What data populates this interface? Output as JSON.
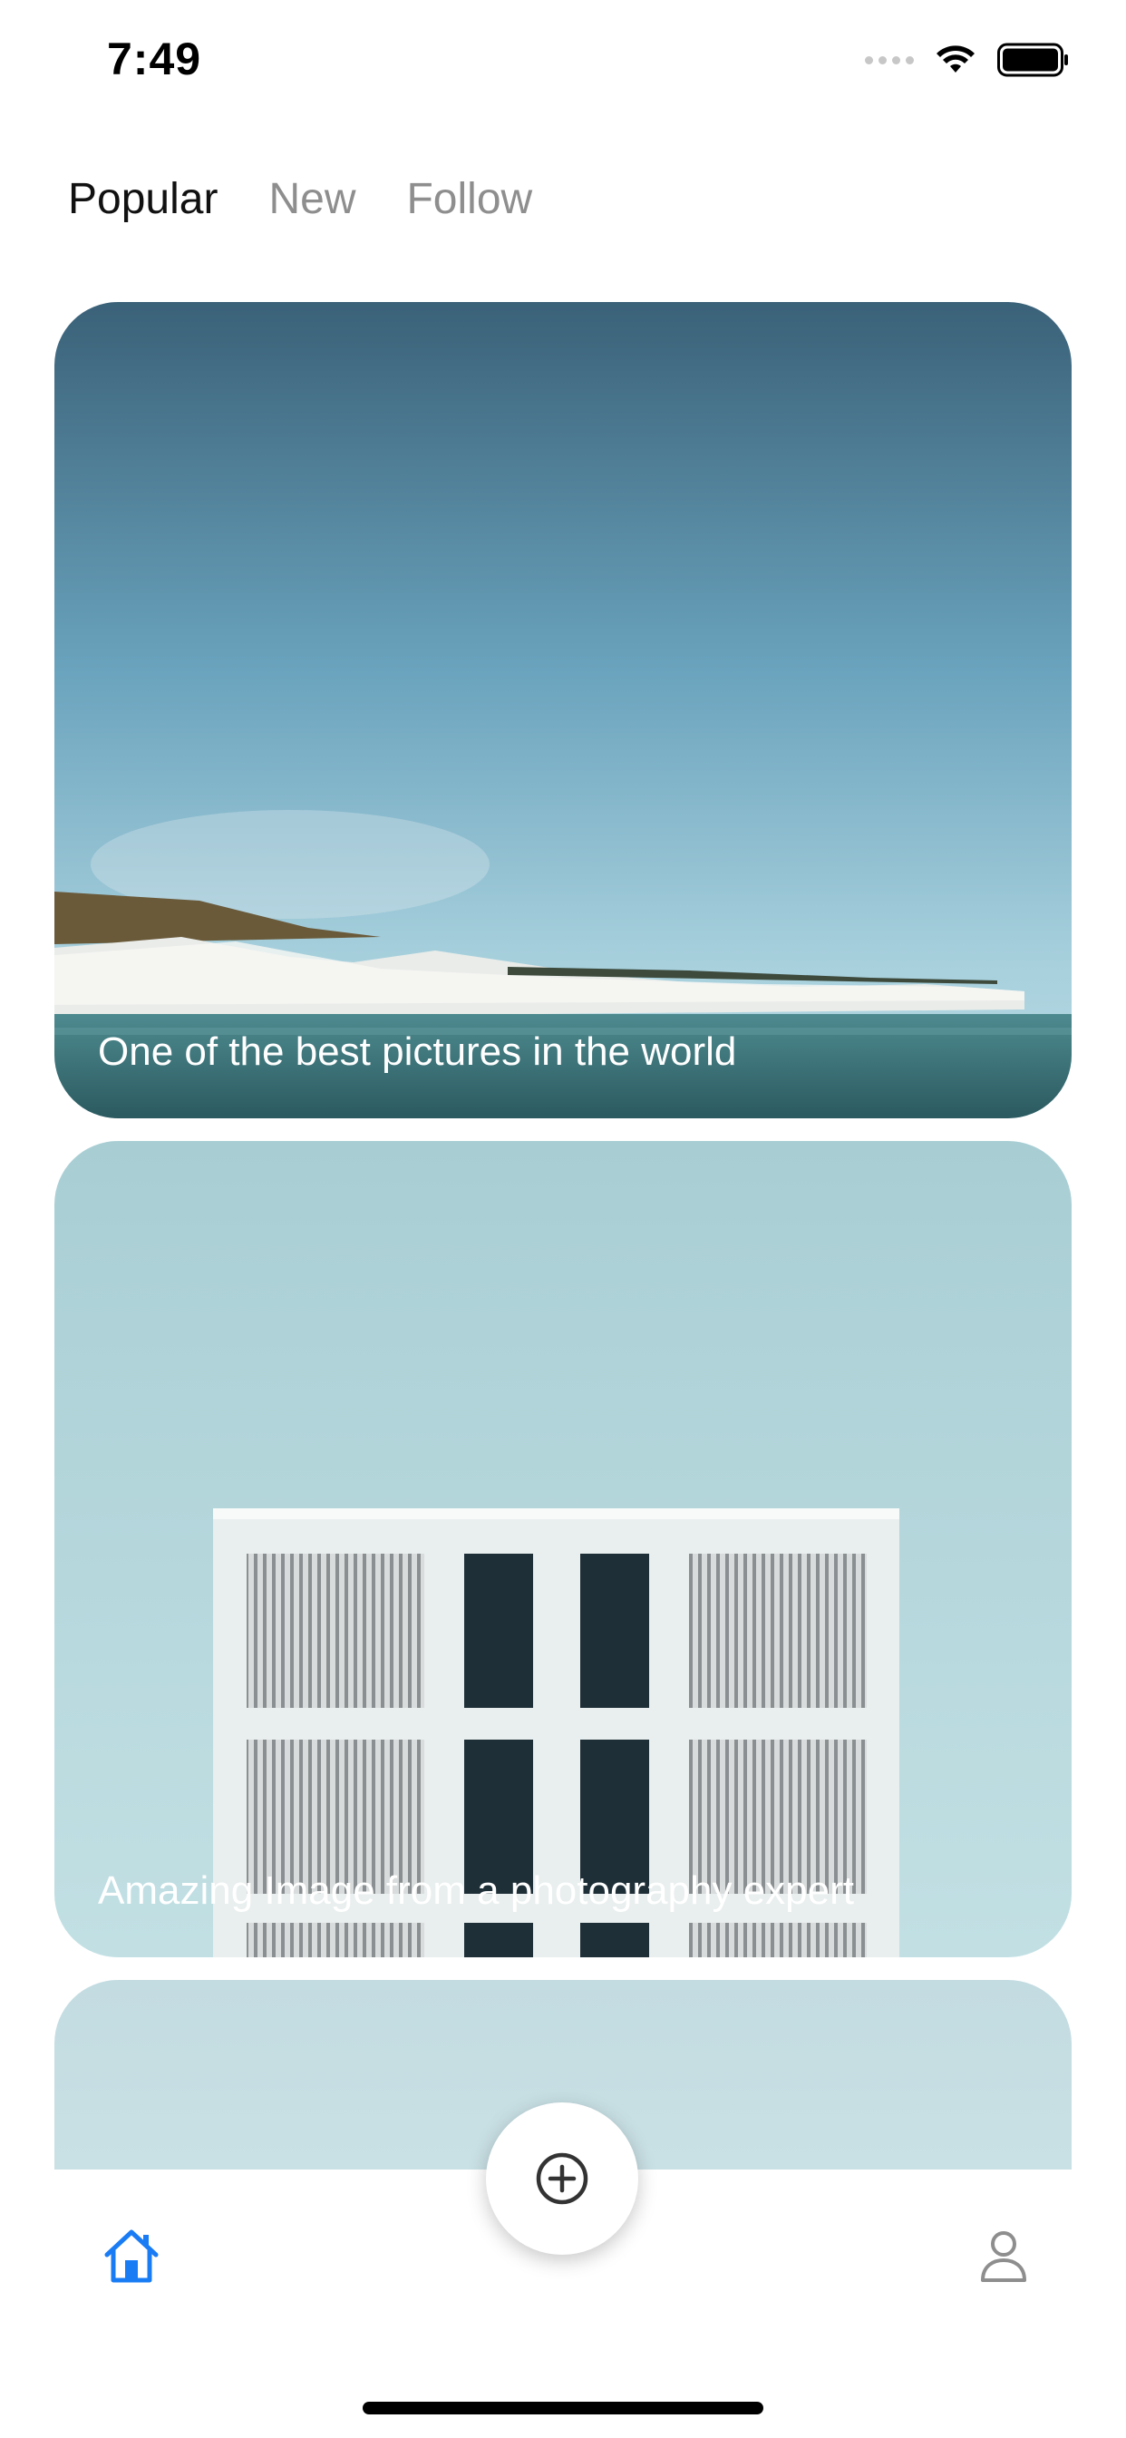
{
  "status_bar": {
    "time": "7:49"
  },
  "tabs": [
    {
      "label": "Popular",
      "active": true
    },
    {
      "label": "New",
      "active": false
    },
    {
      "label": "Follow",
      "active": false
    }
  ],
  "feed": {
    "cards": [
      {
        "caption": "One of the best pictures in the world",
        "image": "white-cliffs-seascape"
      },
      {
        "caption": "Amazing Image from a photography expert",
        "image": "white-building-facade"
      },
      {
        "caption": "",
        "image": "pale-blue-sky"
      }
    ]
  },
  "tab_bar": {
    "home_icon": "home-icon",
    "add_icon": "plus-circle-icon",
    "profile_icon": "person-icon"
  },
  "colors": {
    "accent": "#1a7cf5",
    "tab_inactive": "#8e8e8e",
    "tab_active": "#111111"
  }
}
